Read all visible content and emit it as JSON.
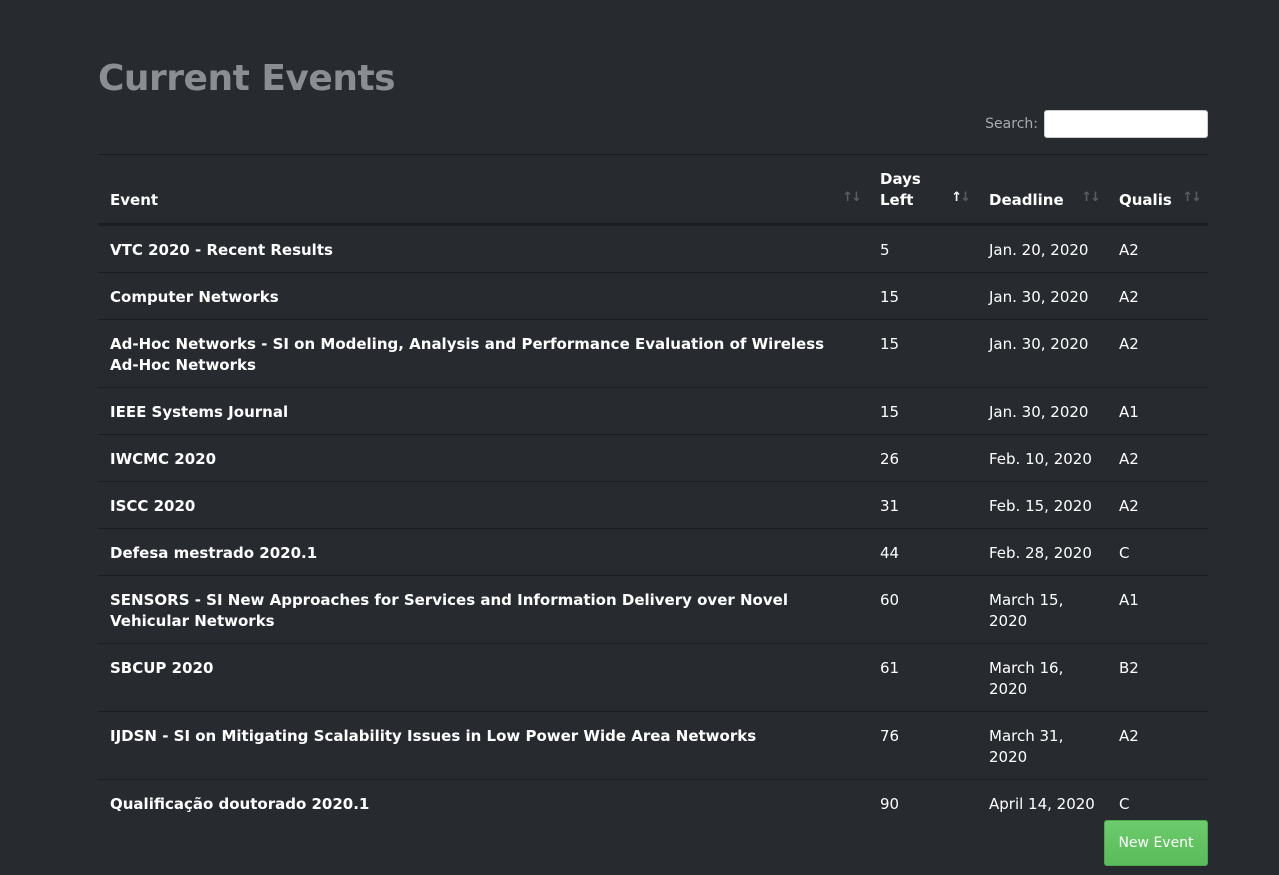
{
  "page": {
    "title": "Current Events"
  },
  "search": {
    "label": "Search:",
    "value": "",
    "placeholder": ""
  },
  "table": {
    "headers": {
      "event": "Event",
      "days_left": "Days Left",
      "deadline": "Deadline",
      "qualis": "Qualis"
    },
    "sort": {
      "column": "days_left",
      "direction": "ascending"
    },
    "rows": [
      {
        "event": "VTC 2020 - Recent Results",
        "days_left": "5",
        "deadline": "Jan. 20, 2020",
        "qualis": "A2"
      },
      {
        "event": "Computer Networks",
        "days_left": "15",
        "deadline": "Jan. 30, 2020",
        "qualis": "A2"
      },
      {
        "event": "Ad-Hoc Networks - SI on Modeling, Analysis and Performance Evaluation of Wireless Ad-Hoc Networks",
        "days_left": "15",
        "deadline": "Jan. 30, 2020",
        "qualis": "A2"
      },
      {
        "event": "IEEE Systems Journal",
        "days_left": "15",
        "deadline": "Jan. 30, 2020",
        "qualis": "A1"
      },
      {
        "event": "IWCMC 2020",
        "days_left": "26",
        "deadline": "Feb. 10, 2020",
        "qualis": "A2"
      },
      {
        "event": "ISCC 2020",
        "days_left": "31",
        "deadline": "Feb. 15, 2020",
        "qualis": "A2"
      },
      {
        "event": "Defesa mestrado 2020.1",
        "days_left": "44",
        "deadline": "Feb. 28, 2020",
        "qualis": "C"
      },
      {
        "event": "SENSORS - SI New Approaches for Services and Information Delivery over Novel Vehicular Networks",
        "days_left": "60",
        "deadline": "March 15, 2020",
        "qualis": "A1"
      },
      {
        "event": "SBCUP 2020",
        "days_left": "61",
        "deadline": "March 16, 2020",
        "qualis": "B2"
      },
      {
        "event": "IJDSN - SI on Mitigating Scalability Issues in Low Power Wide Area Networks",
        "days_left": "76",
        "deadline": "March 31, 2020",
        "qualis": "A2"
      },
      {
        "event": "Qualificação doutorado 2020.1",
        "days_left": "90",
        "deadline": "April 14, 2020",
        "qualis": "C"
      }
    ]
  },
  "actions": {
    "new_event_label": "New Event"
  },
  "icons": {
    "sort_unsorted": "sort-both-icon",
    "sort_ascending": "sort-asc-icon"
  },
  "colors": {
    "background": "#272b30",
    "title": "#8a8e93",
    "button": "#62c462"
  }
}
